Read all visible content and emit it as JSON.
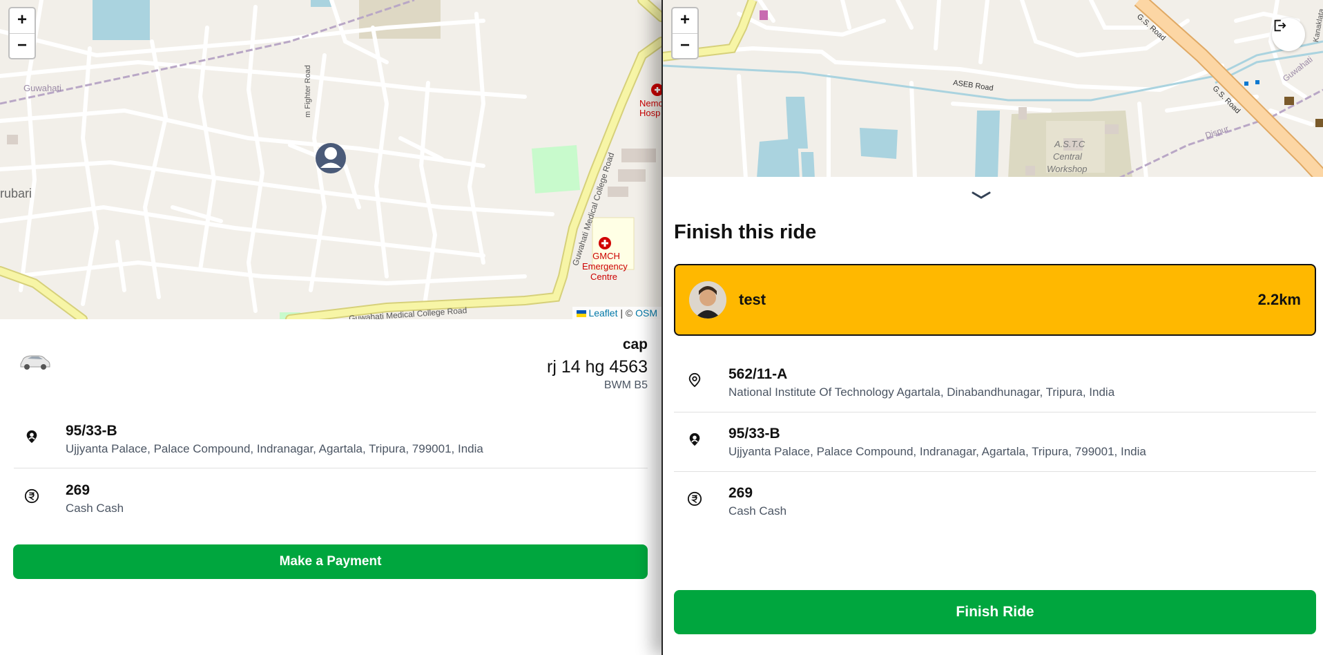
{
  "left_panel": {
    "map": {
      "zoom_in": "+",
      "zoom_out": "−",
      "labels": {
        "guwahati": "Guwahati",
        "rubari": "rubari",
        "fighter_road": "m Fighter Road",
        "medical_college_road": "Guwahati Medical College Road",
        "medical_college_road_bottom": "Guwahati Medical College Road",
        "gmch": "GMCH",
        "emergency": "Emergency",
        "centre": "Centre",
        "nemcare": "Nemc",
        "hospital": "Hosp"
      },
      "attribution": {
        "leaflet": "Leaflet",
        "separator": " | © ",
        "osm": "OSM"
      }
    },
    "driver": {
      "name": "cap",
      "plate": "rj 14 hg 4563",
      "model": "BWM B5",
      "car_icon": "car-icon"
    },
    "destination": {
      "icon": "location-person-icon",
      "title": "95/33-B",
      "address": "Ujjyanta Palace, Palace Compound, Indranagar, Agartala, Tripura, 799001, India"
    },
    "fare": {
      "icon": "rupee-icon",
      "amount": "269",
      "method": "Cash Cash"
    },
    "payment_button": "Make a Payment"
  },
  "right_panel": {
    "map": {
      "zoom_in": "+",
      "zoom_out": "−",
      "logout_icon": "logout-icon",
      "labels": {
        "aseb_road": "ASEB Road",
        "gs_road_top": "G.S. Road",
        "gs_road_mid": "G.S. Road",
        "astc": "A.S.T.C",
        "central": "Central",
        "workshop": "Workshop",
        "dispur": "Dispur",
        "guwahati": "Guwahati",
        "kanaklata": "Kanaklata"
      }
    },
    "sheet_handle_icon": "chevron-down-icon",
    "heading": "Finish this ride",
    "rider": {
      "name": "test",
      "distance": "2.2km",
      "accent": "#FFB800"
    },
    "pickup": {
      "icon": "map-pin-icon",
      "title": "562/11-A",
      "address": "National Institute Of Technology Agartala, Dinabandhunagar, Tripura, India"
    },
    "destination": {
      "icon": "location-person-icon",
      "title": "95/33-B",
      "address": "Ujjyanta Palace, Palace Compound, Indranagar, Agartala, Tripura, 799001, India"
    },
    "fare": {
      "icon": "rupee-icon",
      "amount": "269",
      "method": "Cash Cash"
    },
    "finish_button": "Finish Ride"
  },
  "colors": {
    "primary_green": "#00A63E",
    "rider_card": "#FFB800",
    "map_background": "#F2EFE9"
  }
}
